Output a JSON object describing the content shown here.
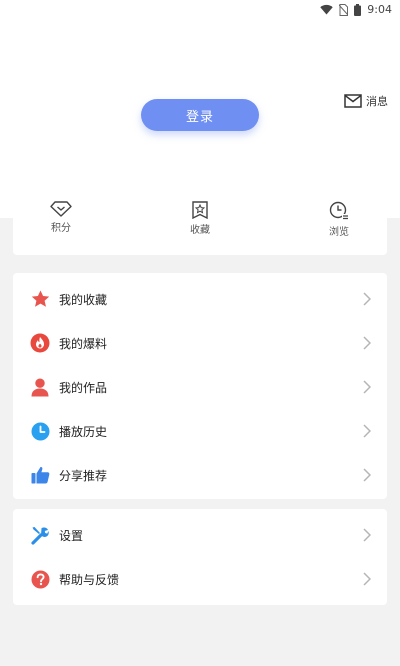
{
  "status_bar": {
    "time": "9:04",
    "icons": [
      "wifi-icon",
      "no-sim-icon",
      "battery-icon"
    ]
  },
  "header": {
    "message_label": "消息",
    "login_label": "登录"
  },
  "stats": [
    {
      "label": "积分",
      "icon": "diamond-icon"
    },
    {
      "label": "收藏",
      "icon": "bookmark-star-icon"
    },
    {
      "label": "浏览",
      "icon": "history-clock-icon"
    }
  ],
  "menu_main": [
    {
      "label": "我的收藏",
      "icon": "star-icon",
      "color": "#e8554e"
    },
    {
      "label": "我的爆料",
      "icon": "flame-icon",
      "color": "#e8483e"
    },
    {
      "label": "我的作品",
      "icon": "person-icon",
      "color": "#e8554e"
    },
    {
      "label": "播放历史",
      "icon": "clock-icon",
      "color": "#2aa0f0"
    },
    {
      "label": "分享推荐",
      "icon": "thumb-up-icon",
      "color": "#3b86e8"
    }
  ],
  "menu_secondary": [
    {
      "label": "设置",
      "icon": "wrench-icon",
      "color": "#2a8fe8"
    },
    {
      "label": "帮助与反馈",
      "icon": "help-icon",
      "color": "#e8554e"
    }
  ]
}
